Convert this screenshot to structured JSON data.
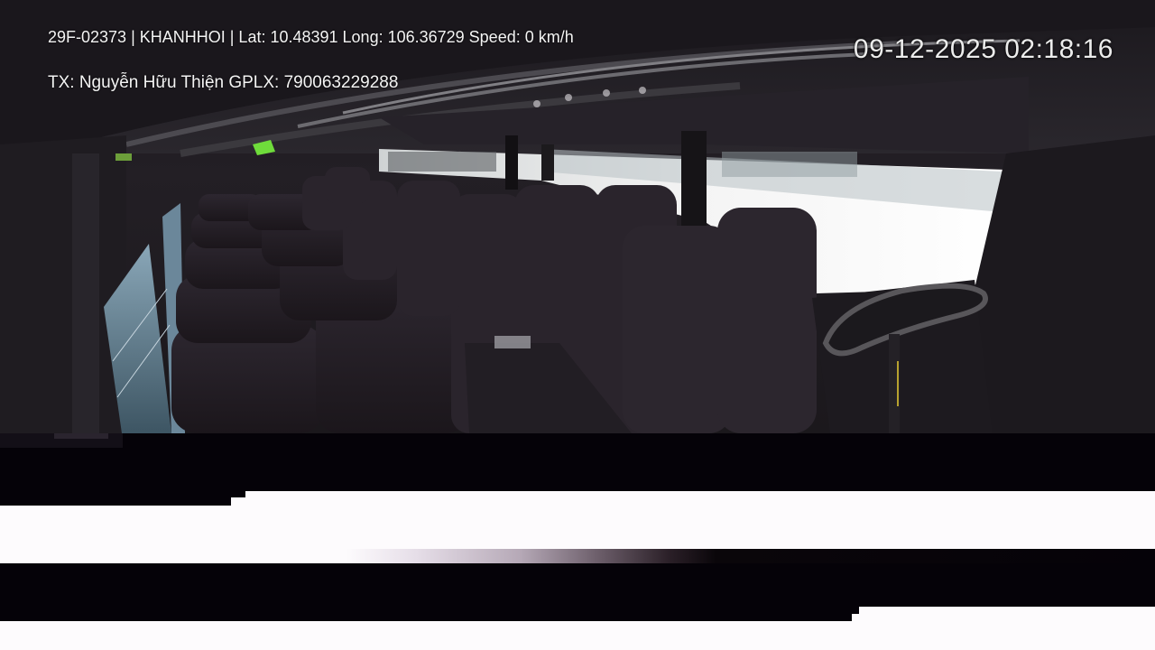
{
  "overlay": {
    "vehicle_info": "29F-02373 | KHANHHOI | Lat: 10.48391 Long: 106.36729 Speed: 0 km/h",
    "driver_info": "TX: Nguyễn Hữu Thiện GPLX: 790063229288",
    "timestamp": "09-12-2025 02:18:16"
  },
  "colors": {
    "overlay_text": "#f4f4f4",
    "glitch_dark": "#050208",
    "glitch_light": "#fdfbfd"
  }
}
